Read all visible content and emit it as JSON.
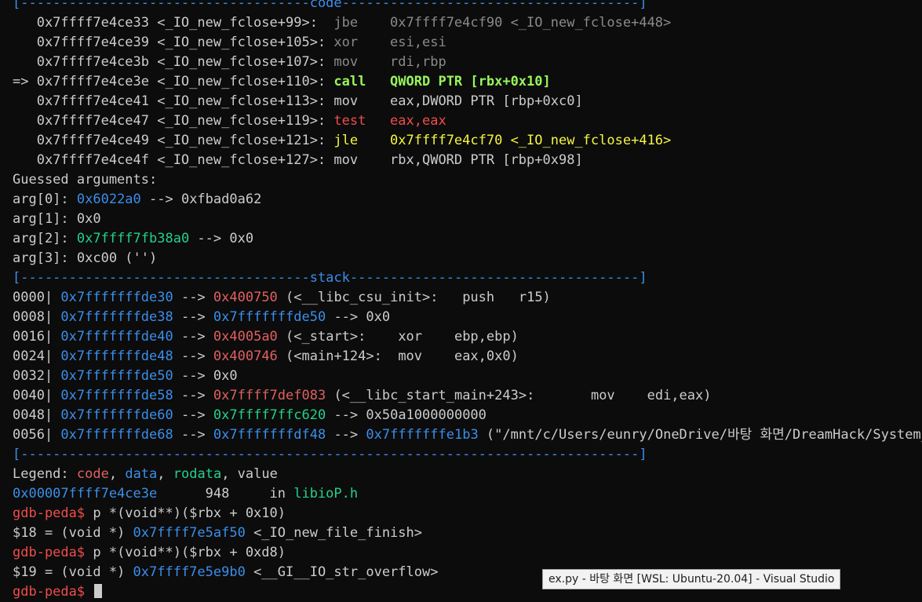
{
  "colors": {
    "default": "#cccccc",
    "blue": "#3b8eea",
    "green": "#23d18b",
    "bright_green": "#98f55a",
    "yellow": "#f5f543",
    "red": "#f14c4c",
    "code_ptr": "#e06060",
    "data_ptr": "#3b8eea",
    "rodata_ptr": "#23d18b",
    "dim": "#8a8a8a",
    "tooltip_bg": "#f2f2f2"
  },
  "terminal": {
    "lines": [
      {
        "segs": [
          {
            "t": "[------------------------------------",
            "c": "blue"
          },
          {
            "t": "code",
            "c": "blue"
          },
          {
            "t": "-------------------------------------]",
            "c": "blue"
          }
        ]
      },
      {
        "segs": [
          {
            "t": "   0x7ffff7e4ce33 <_IO_new_fclose+99>:  ",
            "c": "default"
          },
          {
            "t": "jbe    0x7ffff7e4cf90 <_IO_new_fclose+448>",
            "c": "dim"
          }
        ]
      },
      {
        "segs": [
          {
            "t": "   0x7ffff7e4ce39 <_IO_new_fclose+105>: ",
            "c": "default"
          },
          {
            "t": "xor    esi,esi",
            "c": "dim"
          }
        ]
      },
      {
        "segs": [
          {
            "t": "   0x7ffff7e4ce3b <_IO_new_fclose+107>: ",
            "c": "default"
          },
          {
            "t": "mov    rdi,rbp",
            "c": "dim"
          }
        ]
      },
      {
        "segs": [
          {
            "t": "=> 0x7ffff7e4ce3e <_IO_new_fclose+110>: ",
            "c": "default"
          },
          {
            "t": "call   QWORD PTR [rbx+0x10]",
            "c": "bright_green",
            "b": true
          }
        ]
      },
      {
        "segs": [
          {
            "t": "   0x7ffff7e4ce41 <_IO_new_fclose+113>: mov    eax,DWORD PTR [rbp+0xc0]",
            "c": "default"
          }
        ]
      },
      {
        "segs": [
          {
            "t": "   0x7ffff7e4ce47 <_IO_new_fclose+119>: ",
            "c": "default"
          },
          {
            "t": "test   eax,eax",
            "c": "red"
          }
        ]
      },
      {
        "segs": [
          {
            "t": "   0x7ffff7e4ce49 <_IO_new_fclose+121>: ",
            "c": "default"
          },
          {
            "t": "jle    0x7ffff7e4cf70 <_IO_new_fclose+416>",
            "c": "yellow"
          }
        ]
      },
      {
        "segs": [
          {
            "t": "   0x7ffff7e4ce4f <_IO_new_fclose+127>: mov    rbx,QWORD PTR [rbp+0x98]",
            "c": "default"
          }
        ]
      },
      {
        "segs": [
          {
            "t": "Guessed arguments:",
            "c": "default"
          }
        ]
      },
      {
        "segs": [
          {
            "t": "arg[0]: ",
            "c": "default"
          },
          {
            "t": "0x6022a0",
            "c": "blue"
          },
          {
            "t": " --> 0xfbad0a62",
            "c": "default"
          }
        ]
      },
      {
        "segs": [
          {
            "t": "arg[1]: 0x0",
            "c": "default"
          }
        ]
      },
      {
        "segs": [
          {
            "t": "arg[2]: ",
            "c": "default"
          },
          {
            "t": "0x7ffff7fb38a0",
            "c": "green"
          },
          {
            "t": " --> 0x0",
            "c": "default"
          }
        ]
      },
      {
        "segs": [
          {
            "t": "arg[3]: 0xc00 ('')",
            "c": "default"
          }
        ]
      },
      {
        "segs": [
          {
            "t": "[------------------------------------",
            "c": "blue"
          },
          {
            "t": "stack",
            "c": "blue"
          },
          {
            "t": "------------------------------------]",
            "c": "blue"
          }
        ]
      },
      {
        "segs": [
          {
            "t": "0000| ",
            "c": "default"
          },
          {
            "t": "0x7fffffffde30",
            "c": "blue"
          },
          {
            "t": " --> ",
            "c": "default"
          },
          {
            "t": "0x400750",
            "c": "code_ptr"
          },
          {
            "t": " (<__libc_csu_init>:   push   r15)",
            "c": "default"
          }
        ]
      },
      {
        "segs": [
          {
            "t": "0008| ",
            "c": "default"
          },
          {
            "t": "0x7fffffffde38",
            "c": "blue"
          },
          {
            "t": " --> ",
            "c": "default"
          },
          {
            "t": "0x7fffffffde50",
            "c": "blue"
          },
          {
            "t": " --> 0x0",
            "c": "default"
          }
        ]
      },
      {
        "segs": [
          {
            "t": "0016| ",
            "c": "default"
          },
          {
            "t": "0x7fffffffde40",
            "c": "blue"
          },
          {
            "t": " --> ",
            "c": "default"
          },
          {
            "t": "0x4005a0",
            "c": "code_ptr"
          },
          {
            "t": " (<_start>:    xor    ebp,ebp)",
            "c": "default"
          }
        ]
      },
      {
        "segs": [
          {
            "t": "0024| ",
            "c": "default"
          },
          {
            "t": "0x7fffffffde48",
            "c": "blue"
          },
          {
            "t": " --> ",
            "c": "default"
          },
          {
            "t": "0x400746",
            "c": "code_ptr"
          },
          {
            "t": " (<main+124>:  mov    eax,0x0)",
            "c": "default"
          }
        ]
      },
      {
        "segs": [
          {
            "t": "0032| ",
            "c": "default"
          },
          {
            "t": "0x7fffffffde50",
            "c": "blue"
          },
          {
            "t": " --> 0x0",
            "c": "default"
          }
        ]
      },
      {
        "segs": [
          {
            "t": "0040| ",
            "c": "default"
          },
          {
            "t": "0x7fffffffde58",
            "c": "blue"
          },
          {
            "t": " --> ",
            "c": "default"
          },
          {
            "t": "0x7ffff7def083",
            "c": "code_ptr"
          },
          {
            "t": " (<__libc_start_main+243>:       mov    edi,eax)",
            "c": "default"
          }
        ]
      },
      {
        "segs": [
          {
            "t": "0048| ",
            "c": "default"
          },
          {
            "t": "0x7fffffffde60",
            "c": "blue"
          },
          {
            "t": " --> ",
            "c": "default"
          },
          {
            "t": "0x7ffff7ffc620",
            "c": "green"
          },
          {
            "t": " --> 0x50a1000000000",
            "c": "default"
          }
        ]
      },
      {
        "segs": [
          {
            "t": "0056| ",
            "c": "default"
          },
          {
            "t": "0x7fffffffde68",
            "c": "blue"
          },
          {
            "t": " --> ",
            "c": "default"
          },
          {
            "t": "0x7fffffffdf48",
            "c": "blue"
          },
          {
            "t": " --> ",
            "c": "default"
          },
          {
            "t": "0x7fffffffe1b3",
            "c": "blue"
          },
          {
            "t": " (\"/mnt/c/Users/eunry/OneDrive/바탕 화면/DreamHack/System_",
            "c": "default"
          }
        ]
      },
      {
        "segs": [
          {
            "t": "[-----------------------------------------------------------------------------]",
            "c": "blue"
          }
        ]
      },
      {
        "segs": [
          {
            "t": "Legend: ",
            "c": "default"
          },
          {
            "t": "code",
            "c": "code_ptr"
          },
          {
            "t": ", ",
            "c": "default"
          },
          {
            "t": "data",
            "c": "blue"
          },
          {
            "t": ", ",
            "c": "default"
          },
          {
            "t": "rodata",
            "c": "green"
          },
          {
            "t": ", value",
            "c": "default"
          }
        ]
      },
      {
        "segs": [
          {
            "t": "0x00007ffff7e4ce3e",
            "c": "blue"
          },
          {
            "t": "      948     in ",
            "c": "default"
          },
          {
            "t": "libioP.h",
            "c": "green"
          }
        ]
      },
      {
        "segs": [
          {
            "t": "gdb-peda$",
            "c": "red"
          },
          {
            "t": " p *(void**)($rbx + 0x10)",
            "c": "default"
          }
        ]
      },
      {
        "segs": [
          {
            "t": "$18 = (void *) ",
            "c": "default"
          },
          {
            "t": "0x7ffff7e5af50",
            "c": "blue"
          },
          {
            "t": " <_IO_new_file_finish>",
            "c": "default"
          }
        ]
      },
      {
        "segs": [
          {
            "t": "gdb-peda$",
            "c": "red"
          },
          {
            "t": " p *(void**)($rbx + 0xd8)",
            "c": "default"
          }
        ]
      },
      {
        "segs": [
          {
            "t": "$19 = (void *) ",
            "c": "default"
          },
          {
            "t": "0x7ffff7e5e9b0",
            "c": "blue"
          },
          {
            "t": " <__GI__IO_str_overflow>",
            "c": "default"
          }
        ]
      },
      {
        "segs": [
          {
            "t": "gdb-peda$",
            "c": "red"
          },
          {
            "t": " ",
            "c": "default"
          }
        ],
        "cursor": true
      }
    ]
  },
  "tooltip": {
    "text": "ex.py - 바탕 화면 [WSL: Ubuntu-20.04] - Visual Studio"
  }
}
